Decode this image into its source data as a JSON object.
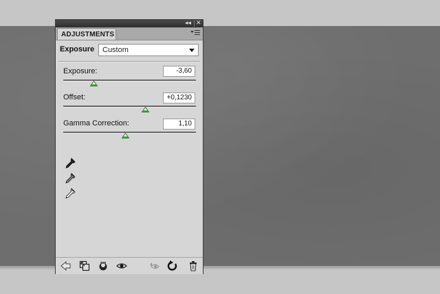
{
  "panel": {
    "tab_label": "ADJUSTMENTS",
    "titlebar_controls": {
      "collapse": "◂◂",
      "close": "✕"
    },
    "menu_icon": "panel-menu-icon"
  },
  "preset": {
    "label": "Exposure",
    "selected": "Custom"
  },
  "controls": [
    {
      "label": "Exposure:",
      "value": "-3,60",
      "slider_fraction": 0.23
    },
    {
      "label": "Offset:",
      "value": "+0,1230",
      "slider_fraction": 0.62
    },
    {
      "label": "Gamma Correction:",
      "value": "1,10",
      "slider_fraction": 0.47
    }
  ],
  "eyedroppers": [
    "black-point-eyedropper-icon",
    "gray-point-eyedropper-icon",
    "white-point-eyedropper-icon"
  ],
  "bottom_icons": [
    "back-arrow-icon",
    "expand-view-icon",
    "clip-to-layer-icon",
    "visibility-eye-icon",
    "view-previous-state-icon",
    "reset-icon",
    "trash-icon"
  ],
  "colors": {
    "canvas": "#6e6e6e",
    "panel_bg": "#d6d6d6",
    "slider_thumb": "#2e9e2e"
  }
}
